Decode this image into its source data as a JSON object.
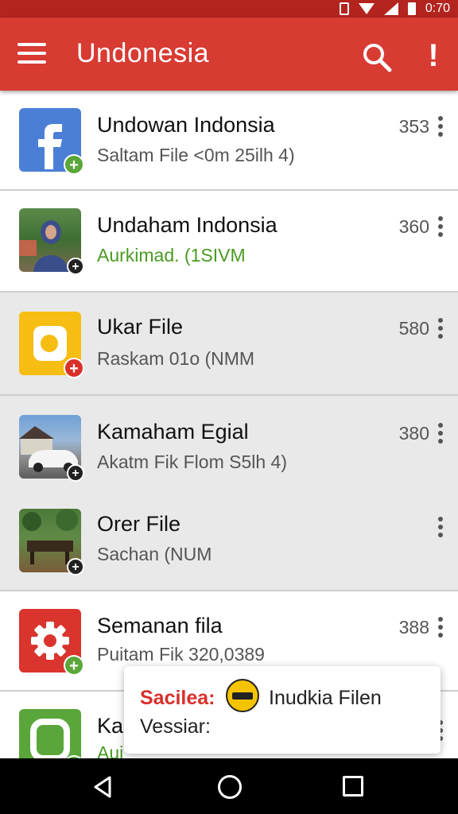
{
  "status_bar": {
    "time": "0:70",
    "icons": [
      "vibrate-icon",
      "wifi-icon",
      "signal-icon",
      "battery-icon"
    ]
  },
  "toolbar": {
    "title": "Undonesia",
    "icons": [
      "menu-icon",
      "search-icon",
      "more-icon"
    ],
    "more_glyph": "!"
  },
  "list": {
    "items": [
      {
        "title": "Undowan Indonsia",
        "subtitle": "Saltam File <0m 25ilh 4)",
        "count": "353",
        "thumb": "facebook-icon",
        "badge": "+"
      },
      {
        "title": "Undaham Indonsia",
        "subtitle": "Aurkimad. (1SIVM",
        "count": "360",
        "thumb": "person-photo",
        "badge": "+"
      },
      {
        "title": "Ukar File",
        "subtitle": "Raskam 01o (NMM",
        "count": "580",
        "thumb": "yellow-app-icon",
        "badge": "+"
      },
      {
        "title": "Kamaham Egial",
        "subtitle": "Akatm Fik Flom S5lh 4)",
        "count": "380",
        "thumb": "car-photo",
        "badge": "+"
      },
      {
        "title": "Orer File",
        "subtitle": "Sachan (NUM",
        "count": "",
        "thumb": "garden-photo",
        "badge": "+"
      },
      {
        "title": "Semanan fila",
        "subtitle": "Puitam Fik 320,0389",
        "count": "388",
        "thumb": "gear-icon",
        "badge": "+"
      },
      {
        "title": "Kar",
        "subtitle": "Aui",
        "count": "",
        "thumb": "green-app-icon",
        "badge": "+"
      }
    ]
  },
  "toast": {
    "label": "Sacilea:",
    "name": "Inudkia Filen",
    "subtitle": "Vessiar:"
  },
  "colors": {
    "status_bar": "#b3241f",
    "toolbar": "#d73b32",
    "badge_green": "#5aa63a",
    "badge_red": "#d9312a",
    "subtitle_green": "#4a9a22"
  }
}
